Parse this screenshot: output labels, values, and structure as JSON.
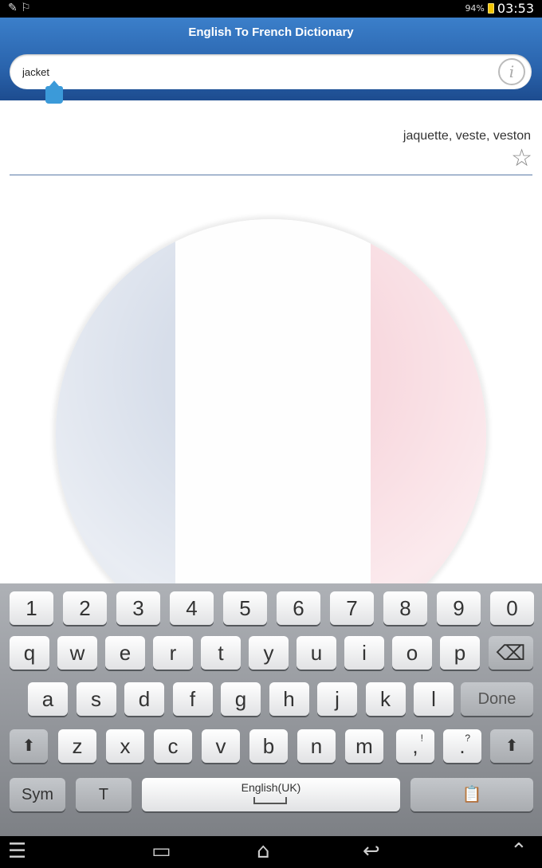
{
  "status_bar": {
    "left_icons": "✎ ⚐",
    "battery_pct": "94%",
    "time": "03:53"
  },
  "header": {
    "title": "English To French Dictionary"
  },
  "search": {
    "value": "jacket"
  },
  "result": {
    "translation": "jaquette, veste, veston"
  },
  "keyboard": {
    "row_numbers": [
      "1",
      "2",
      "3",
      "4",
      "5",
      "6",
      "7",
      "8",
      "9",
      "0"
    ],
    "row_top": [
      "q",
      "w",
      "e",
      "r",
      "t",
      "y",
      "u",
      "i",
      "o",
      "p"
    ],
    "row_middle": [
      "a",
      "s",
      "d",
      "f",
      "g",
      "h",
      "j",
      "k",
      "l"
    ],
    "row_bottom": [
      "z",
      "x",
      "c",
      "v",
      "b",
      "n",
      "m"
    ],
    "comma_key": ",",
    "comma_sub": "!",
    "period_key": ".",
    "period_sub": "?",
    "done_label": "Done",
    "sym_label": "Sym",
    "handwriting_label": "T",
    "space_label": "English(UK)",
    "backspace_icon": "⌫",
    "shift_icon": "⬆",
    "clipboard_icon": "📋"
  },
  "colors": {
    "header_blue": "#2a64ad",
    "flag_blue": "#d7deea",
    "flag_red": "#f8d9df",
    "cursor_handle": "#3b9ad9"
  }
}
